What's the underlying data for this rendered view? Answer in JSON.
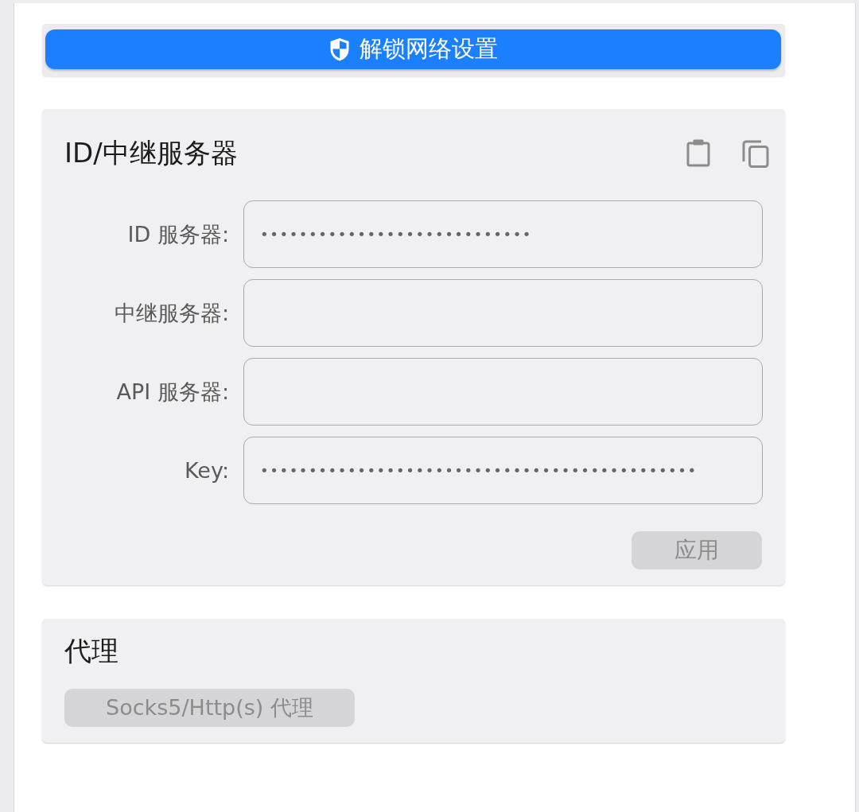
{
  "unlock_button": {
    "label": "解锁网络设置"
  },
  "server_card": {
    "title": "ID/中继服务器",
    "fields": [
      {
        "label": "ID 服务器:",
        "value": "••••••••••••••••••••••••••••"
      },
      {
        "label": "中继服务器:"
      },
      {
        "label": "API 服务器:"
      },
      {
        "label": "Key:",
        "value": "•••••••••••••••••••••••••••••••••••••••••••••"
      }
    ],
    "apply_button": {
      "label": "应用",
      "disabled": true
    }
  },
  "proxy_card": {
    "title": "代理",
    "proxy_button": {
      "label": "Socks5/Http(s) 代理",
      "disabled": true
    }
  }
}
